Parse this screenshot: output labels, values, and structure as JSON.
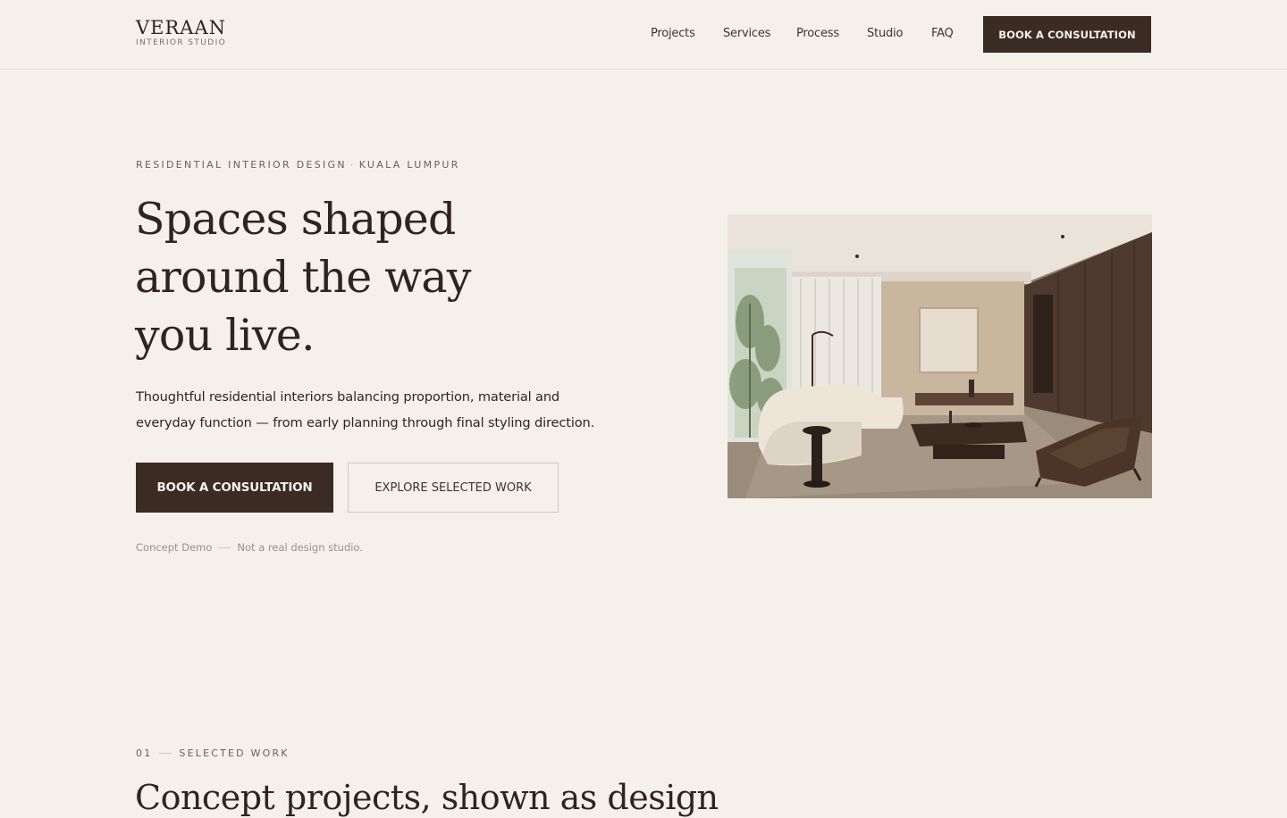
{
  "brand": {
    "name": "VERAAN",
    "tagline": "INTERIOR STUDIO"
  },
  "nav": {
    "items": [
      "Projects",
      "Services",
      "Process",
      "Studio",
      "FAQ"
    ],
    "cta_label": "BOOK A CONSULTATION"
  },
  "hero": {
    "eyebrow_left": "RESIDENTIAL INTERIOR DESIGN",
    "eyebrow_separator": "·",
    "eyebrow_right": "KUALA LUMPUR",
    "headline_lines": [
      "Spaces shaped",
      "around the way",
      "you live."
    ],
    "lead_lines": [
      "Thoughtful residential interiors balancing proportion, material and",
      "everyday function — from early planning through final styling direction."
    ],
    "primary_button": "BOOK A CONSULTATION",
    "secondary_button": "EXPLORE SELECTED WORK",
    "note_left": "Concept Demo",
    "note_right": "Not a real design studio.",
    "image_icon": "living-room-photo"
  },
  "section_work": {
    "number": "01",
    "label": "SELECTED WORK",
    "heading": "Concept projects, shown as design"
  },
  "colors": {
    "background": "#f5f1ea",
    "accent_dark": "#3a2b23",
    "text": "#2f2520",
    "muted": "#6b6058",
    "border": "#cfc6bb"
  }
}
